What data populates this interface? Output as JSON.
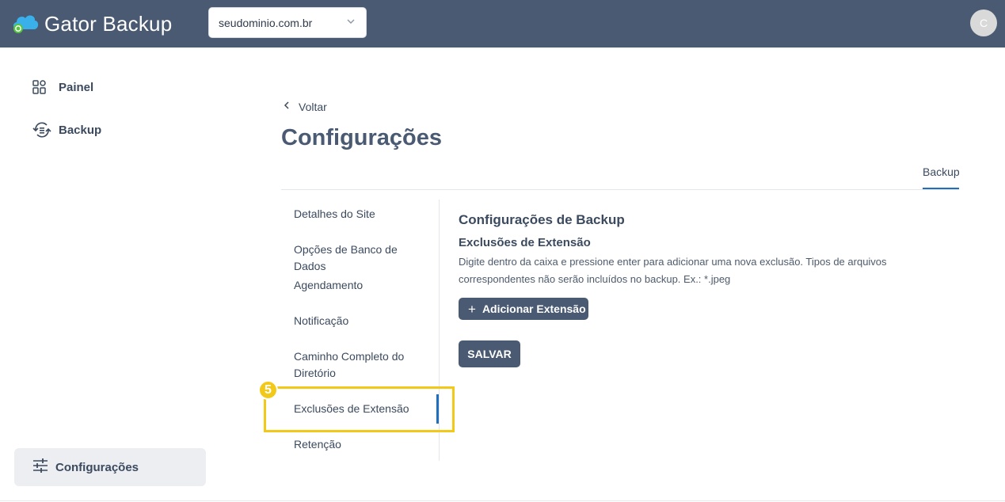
{
  "header": {
    "brand_name": "Gator Backup",
    "domain_select_value": "seudominio.com.br",
    "avatar_initial": "C"
  },
  "sidebar": {
    "items": [
      {
        "label": "Painel",
        "icon": "dashboard-grid-icon"
      },
      {
        "label": "Backup",
        "icon": "backup-sync-icon"
      }
    ],
    "active_item": {
      "label": "Configurações",
      "icon": "sliders-icon"
    }
  },
  "main": {
    "back_label": "Voltar",
    "page_title": "Configurações",
    "tabs": [
      {
        "label": "Backup",
        "active": true
      }
    ],
    "subnav": [
      {
        "label": "Detalhes do Site"
      },
      {
        "label": "Opções de Banco de Dados"
      },
      {
        "label": "Agendamento"
      },
      {
        "label": "Notificação"
      },
      {
        "label": "Caminho Completo do Diretório"
      },
      {
        "label": "Exclusões de Extensão",
        "active": true
      },
      {
        "label": "Retenção"
      }
    ],
    "section_title": "Configurações de Backup",
    "section_subtitle": "Exclusões de Extensão",
    "section_description": "Digite dentro da caixa e pressione enter para adicionar uma nova exclusão. Tipos de arquivos correspondentes não serão incluídos no backup. Ex.: *.jpeg",
    "add_button_label": "Adicionar Extensão",
    "save_button_label": "SALVAR"
  },
  "annotation": {
    "step_number": "5",
    "color": "#f2c919"
  },
  "colors": {
    "header_bg": "#4a5a72",
    "accent": "#1f6fbf",
    "button_bg": "#4a5a72"
  }
}
